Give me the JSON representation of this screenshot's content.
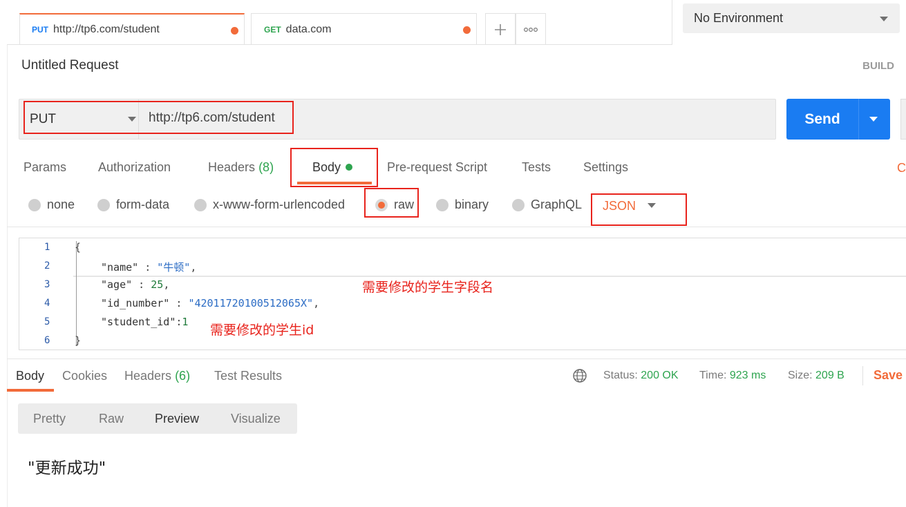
{
  "tabs": [
    {
      "method": "PUT",
      "url": "http://tp6.com/student",
      "method_color": "#1a7cf2"
    },
    {
      "method": "GET",
      "url": "data.com",
      "method_color": "#2ea44f"
    }
  ],
  "tab_actions": {
    "new_tab_icon": "plus-icon",
    "more_icon": "more-icon"
  },
  "environment": {
    "selected": "No Environment"
  },
  "request": {
    "title": "Untitled Request",
    "build_label": "BUILD"
  },
  "url_bar": {
    "method": "PUT",
    "url": "http://tp6.com/student"
  },
  "send_button": {
    "label": "Send"
  },
  "request_tabs": {
    "params": "Params",
    "authorization": "Authorization",
    "headers": "Headers",
    "headers_count": "(8)",
    "body": "Body",
    "prerequest": "Pre-request Script",
    "tests": "Tests",
    "settings": "Settings",
    "cut_off": "C"
  },
  "body_types": {
    "none": "none",
    "form_data": "form-data",
    "urlencoded": "x-www-form-urlencoded",
    "raw": "raw",
    "binary": "binary",
    "graphql": "GraphQL",
    "format": "JSON"
  },
  "editor": {
    "line_numbers": [
      "1",
      "2",
      "3",
      "4",
      "5",
      "6"
    ],
    "lines": {
      "l1": "{",
      "l2_key": "\"name\"",
      "l2_sep": " : ",
      "l2_val": "\"牛顿\"",
      "l2_end": ",",
      "l3_key": "\"age\"",
      "l3_sep": " : ",
      "l3_val": "25",
      "l3_end": ",",
      "l4_key": "\"id_number\"",
      "l4_sep": " : ",
      "l4_val": "\"42011720100512065X\"",
      "l4_end": ",",
      "l5_key": "\"student_id\"",
      "l5_sep": ":",
      "l5_val": "1",
      "l6": "}"
    }
  },
  "annotations": {
    "fields_note": "需要修改的学生字段名",
    "id_note": "需要修改的学生id"
  },
  "response_tabs": {
    "body": "Body",
    "cookies": "Cookies",
    "headers": "Headers",
    "headers_count": "(6)",
    "test_results": "Test Results"
  },
  "response_meta": {
    "status_label": "Status:",
    "status_value": "200 OK",
    "time_label": "Time:",
    "time_value": "923 ms",
    "size_label": "Size:",
    "size_value": "209 B",
    "save_label": "Save"
  },
  "view_modes": {
    "pretty": "Pretty",
    "raw": "Raw",
    "preview": "Preview",
    "visualize": "Visualize",
    "selected": "Preview"
  },
  "response_body": "\"更新成功\"",
  "colors": {
    "accent": "#f26b3a",
    "send": "#1a7cf2",
    "success": "#2ea44f",
    "annotation": "#e8231c"
  }
}
